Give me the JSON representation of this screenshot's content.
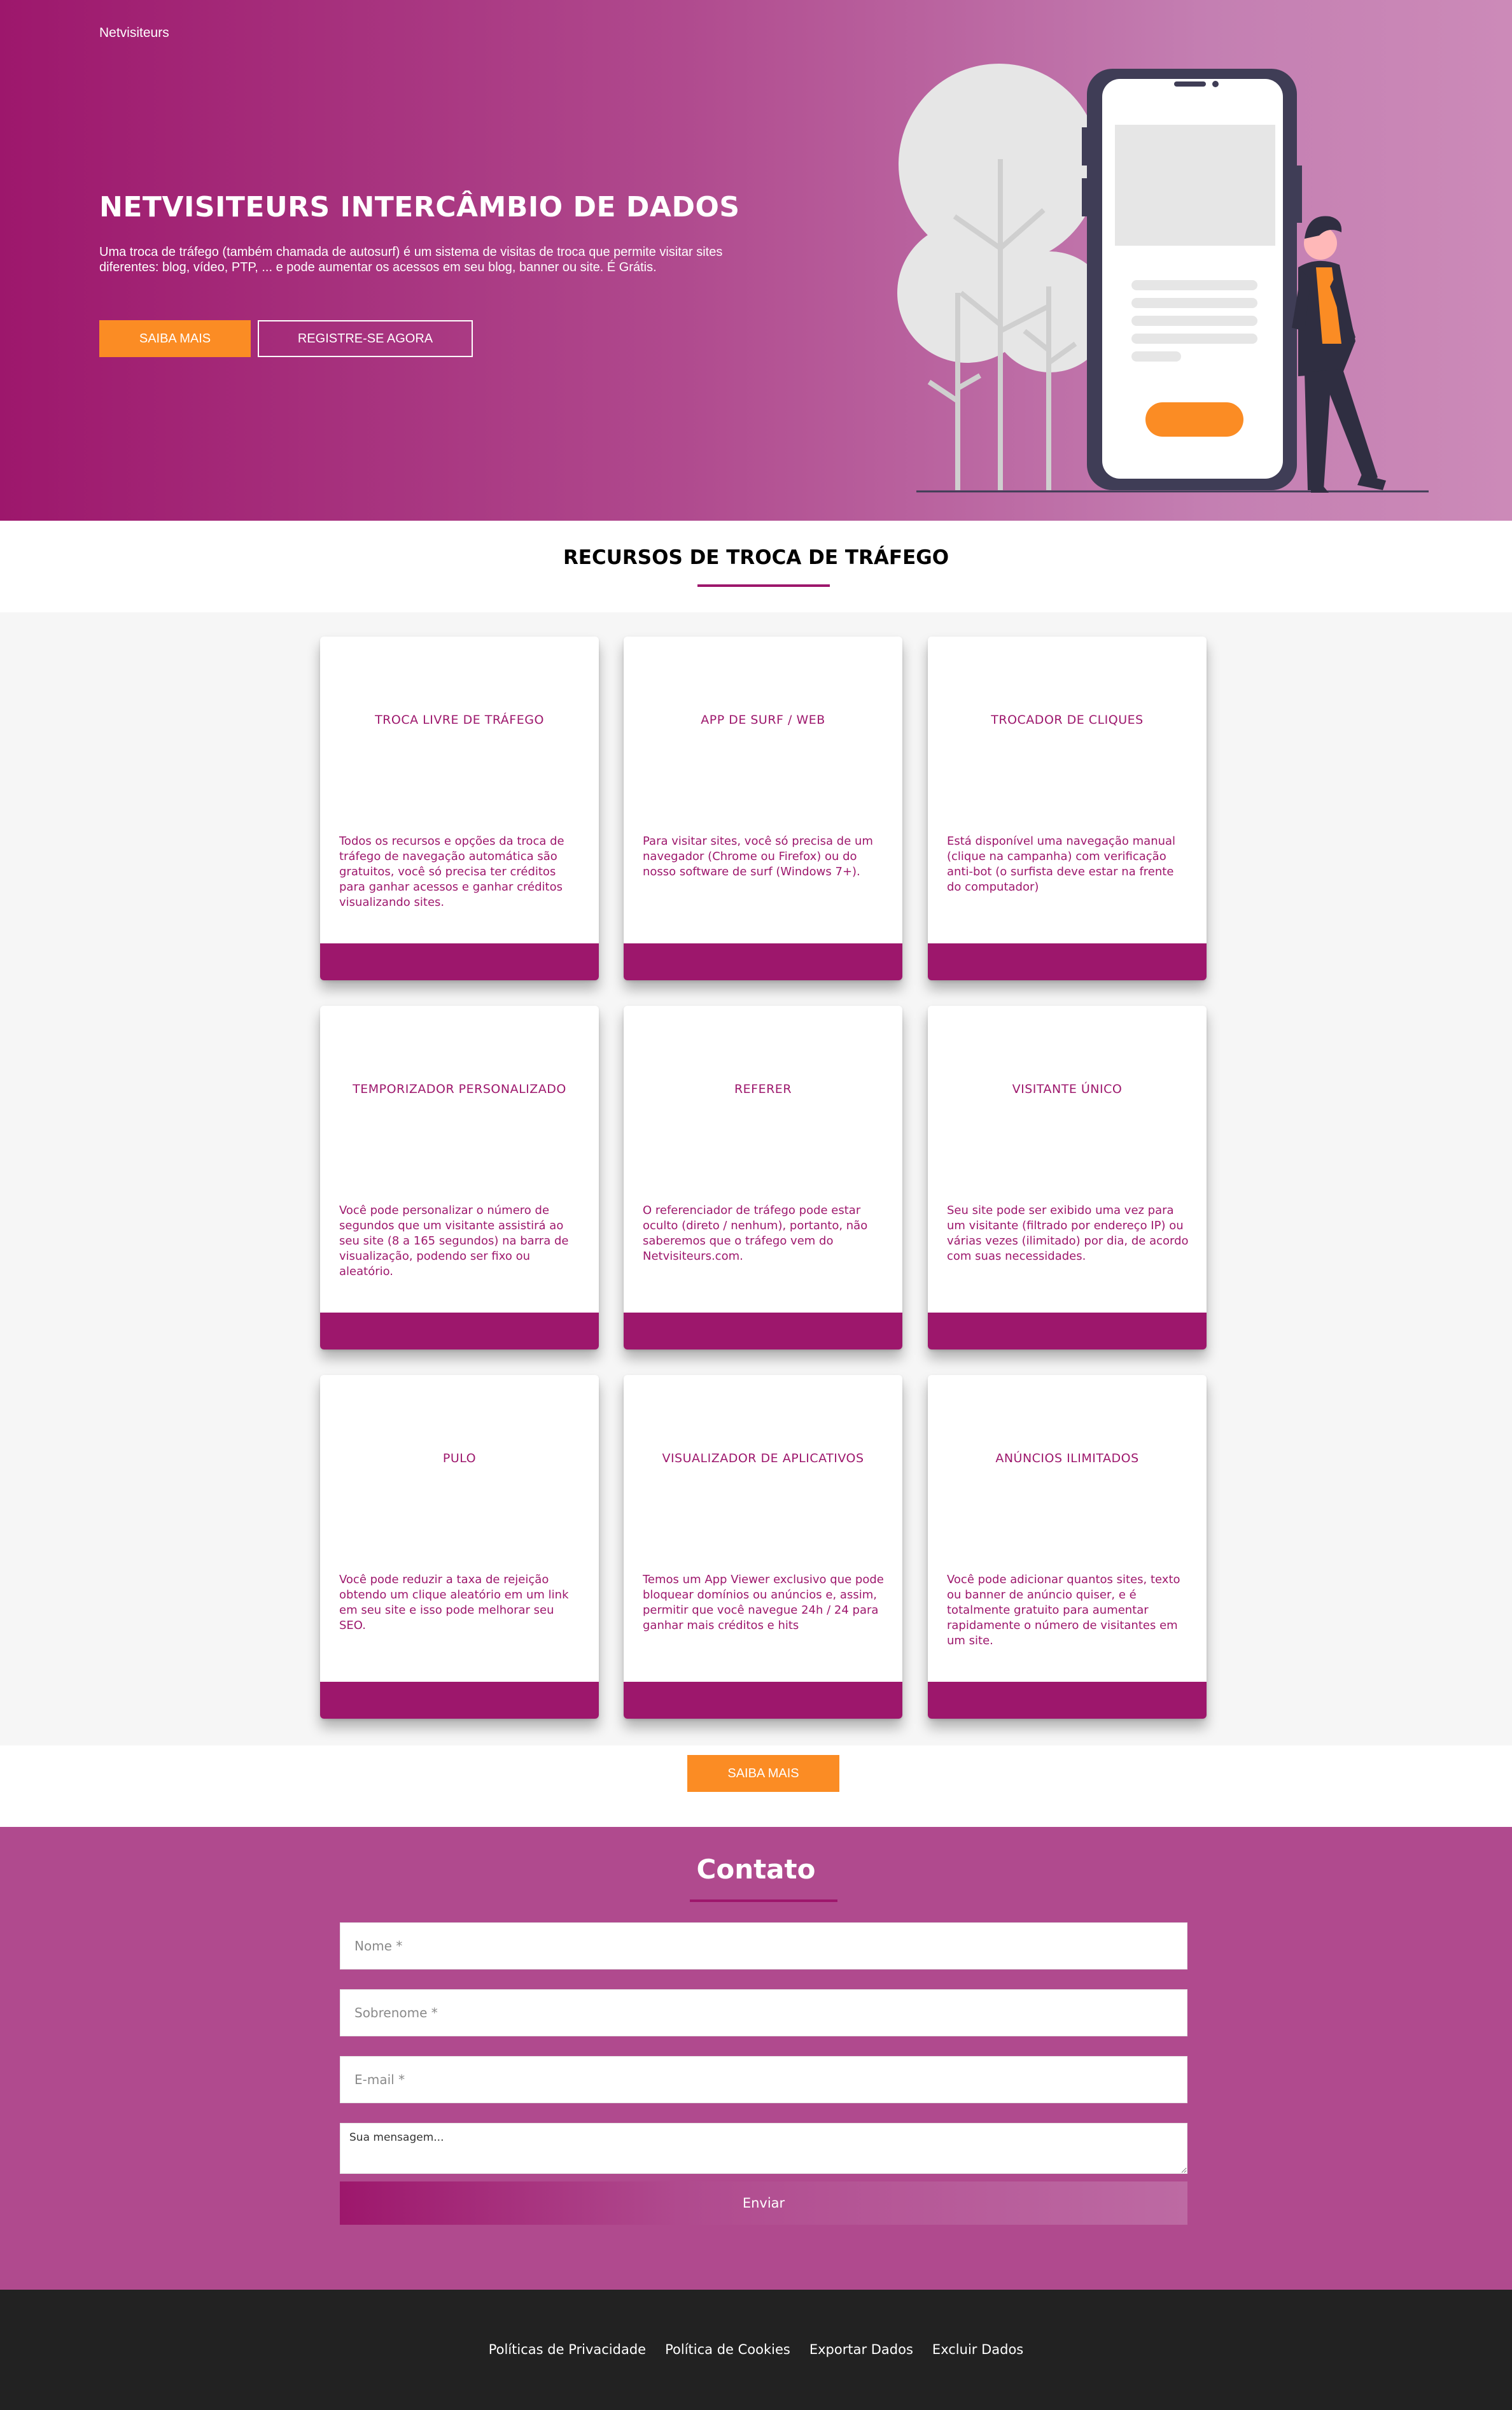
{
  "header": {
    "brand": "Netvisiteurs"
  },
  "hero": {
    "title": "NETVISITEURS INTERCÂMBIO DE DADOS",
    "description": "Uma troca de tráfego (também chamada de autosurf) é um sistema de visitas de troca que permite visitar sites diferentes: blog, vídeo, PTP, ... e pode aumentar os acessos em seu blog, banner ou site. É Grátis.",
    "primary_button": "SAIBA MAIS",
    "secondary_button": "REGISTRE-SE AGORA"
  },
  "features": {
    "title": "RECURSOS DE TROCA DE TRÁFEGO",
    "cards": [
      {
        "title": "TROCA LIVRE DE TRÁFEGO",
        "text": "Todos os recursos e opções da troca de tráfego de navegação automática são gratuitos, você só precisa ter créditos para ganhar acessos e ganhar créditos visualizando sites."
      },
      {
        "title": "APP DE SURF / WEB",
        "text": "Para visitar sites, você só precisa de um navegador (Chrome ou Firefox) ou do nosso software de surf (Windows 7+)."
      },
      {
        "title": "TROCADOR DE CLIQUES",
        "text": "Está disponível uma navegação manual (clique na campanha) com verificação anti-bot (o surfista deve estar na frente do computador)"
      },
      {
        "title": "TEMPORIZADOR PERSONALIZADO",
        "text": "Você pode personalizar o número de segundos que um visitante assistirá ao seu site (8 a 165 segundos) na barra de visualização, podendo ser fixo ou aleatório."
      },
      {
        "title": "REFERER",
        "text": "O referenciador de tráfego pode estar oculto (direto / nenhum), portanto, não saberemos que o tráfego vem do Netvisiteurs.com."
      },
      {
        "title": "VISITANTE ÚNICO",
        "text": "Seu site pode ser exibido uma vez para um visitante (filtrado por endereço IP) ou várias vezes (ilimitado) por dia, de acordo com suas necessidades."
      },
      {
        "title": "PULO",
        "text": "Você pode reduzir a taxa de rejeição obtendo um clique aleatório em um link em seu site e isso pode melhorar seu SEO."
      },
      {
        "title": "VISUALIZADOR DE APLICATIVOS",
        "text": "Temos um App Viewer exclusivo que pode bloquear domínios ou anúncios e, assim, permitir que você navegue 24h / 24 para ganhar mais créditos e hits"
      },
      {
        "title": "ANÚNCIOS ILIMITADOS",
        "text": "Você pode adicionar quantos sites, texto ou banner de anúncio quiser, e é totalmente gratuito para aumentar rapidamente o número de visitantes em um site."
      }
    ],
    "more_button": "SAIBA MAIS"
  },
  "contact": {
    "title": "Contato",
    "first_name_placeholder": "Nome *",
    "last_name_placeholder": "Sobrenome *",
    "email_placeholder": "E-mail *",
    "message_placeholder": "Sua mensagem...",
    "submit_label": "Enviar"
  },
  "footer": {
    "links": [
      "Políticas de Privacidade",
      "Política de Cookies",
      "Exportar Dados",
      "Excluir Dados"
    ]
  },
  "colors": {
    "brand_magenta": "#9d176c",
    "contact_bg": "#b04a8e",
    "accent_orange": "#fb8c24",
    "footer_bg": "#222222"
  }
}
